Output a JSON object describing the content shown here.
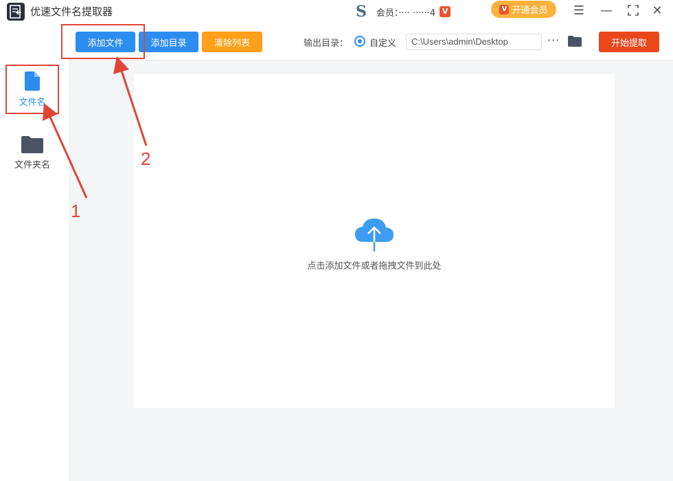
{
  "app": {
    "title": "优速文件名提取器",
    "member_text": "会员：···· ······4",
    "open_vip_label": "开通会员",
    "vip_badge": "V"
  },
  "window_controls": {
    "menu": "☰",
    "minimize": "—",
    "maximize": "⛶",
    "close": "✕"
  },
  "sidebar": {
    "items": [
      {
        "label": "文件名",
        "icon": "file-icon",
        "active": true
      },
      {
        "label": "文件夹名",
        "icon": "folder-icon",
        "active": false
      }
    ]
  },
  "toolbar": {
    "add_file": "添加文件",
    "add_dir": "添加目录",
    "clear_list": "清除列表",
    "output_label": "输出目录：",
    "radio_label": "自定义",
    "output_path": "C:\\Users\\admin\\Desktop",
    "more": "···",
    "start": "开始提取"
  },
  "dropzone": {
    "hint": "点击添加文件或者拖拽文件到此处"
  },
  "annotations": {
    "step1": "1",
    "step2": "2"
  },
  "colors": {
    "primary": "#2d8cf0",
    "orange": "#ff9f1a",
    "start_red": "#e8481c",
    "annotation_red": "#e0453a",
    "vip_gold": "#ffb13d"
  }
}
